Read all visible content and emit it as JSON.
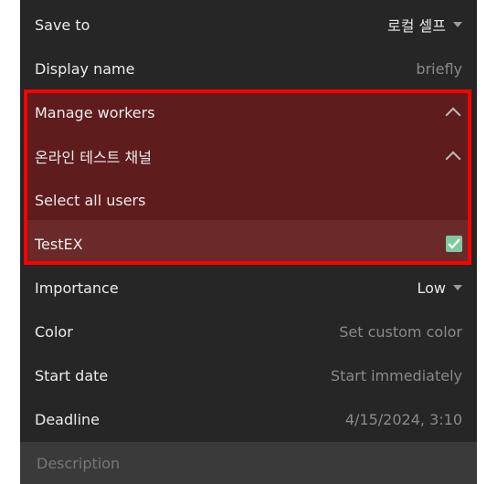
{
  "form": {
    "save_to": {
      "label": "Save to",
      "value": "로컬 셀프"
    },
    "display_name": {
      "label": "Display name",
      "value": "briefly"
    },
    "manage_workers": {
      "label": "Manage workers"
    },
    "channel": {
      "label": "온라인 테스트 채널"
    },
    "select_all": {
      "label": "Select all users"
    },
    "user_item": {
      "label": "TestEX",
      "checked": true
    },
    "importance": {
      "label": "Importance",
      "value": "Low"
    },
    "color": {
      "label": "Color",
      "value": "Set custom color"
    },
    "start_date": {
      "label": "Start date",
      "value": "Start immediately"
    },
    "deadline": {
      "label": "Deadline",
      "value": "4/15/2024, 3:10"
    },
    "description": {
      "placeholder": "Description"
    }
  },
  "colors": {
    "panel_bg": "#262626",
    "highlight_bg": "#5f1c1d",
    "highlight_border": "#ff0000",
    "checkbox": "#7fc9a0"
  },
  "icons": {
    "dropdown": "caret-down-icon",
    "collapse": "chevron-up-icon",
    "checked": "checkbox-checked-icon"
  }
}
